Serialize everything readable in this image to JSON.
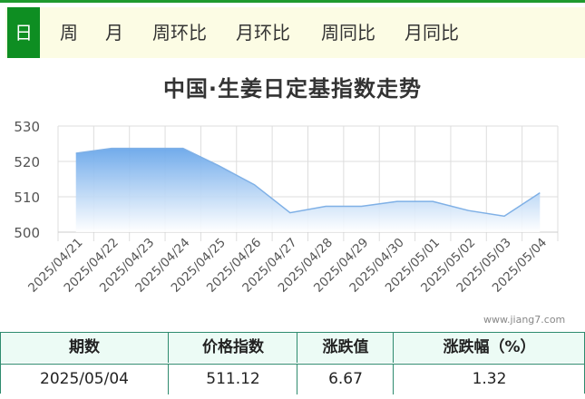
{
  "tabs": [
    {
      "label": "日",
      "active": true
    },
    {
      "label": "周"
    },
    {
      "label": "月"
    },
    {
      "label": "周环比"
    },
    {
      "label": "月环比"
    },
    {
      "label": "周同比"
    },
    {
      "label": "月同比"
    }
  ],
  "chart_data": {
    "type": "area",
    "title": "中国·生姜日定基指数走势",
    "xlabel": "",
    "ylabel": "",
    "categories": [
      "2025/04/21",
      "2025/04/22",
      "2025/04/23",
      "2025/04/24",
      "2025/04/25",
      "2025/04/26",
      "2025/04/27",
      "2025/04/28",
      "2025/04/29",
      "2025/04/30",
      "2025/05/01",
      "2025/05/02",
      "2025/05/03",
      "2025/05/04"
    ],
    "series": [
      {
        "values": [
          522.3,
          523.7,
          523.7,
          523.7,
          518.8,
          513.4,
          505.5,
          507.3,
          507.3,
          508.7,
          508.7,
          506.1,
          504.5,
          511.12
        ]
      }
    ],
    "ylim": [
      500,
      530
    ],
    "yticks": [
      500,
      510,
      520,
      530
    ],
    "grid": true,
    "legend": "none",
    "colors": {
      "line": "#7fb0e6",
      "fill_top": "#6aa7ea",
      "fill_bottom": "#ffffff",
      "grid": "#dddddd"
    }
  },
  "watermark": "www.jiang7.com",
  "table": {
    "headers": [
      "期数",
      "价格指数",
      "涨跌值",
      "涨跌幅（%）"
    ],
    "row": [
      "2025/05/04",
      "511.12",
      "6.67",
      "1.32"
    ]
  }
}
